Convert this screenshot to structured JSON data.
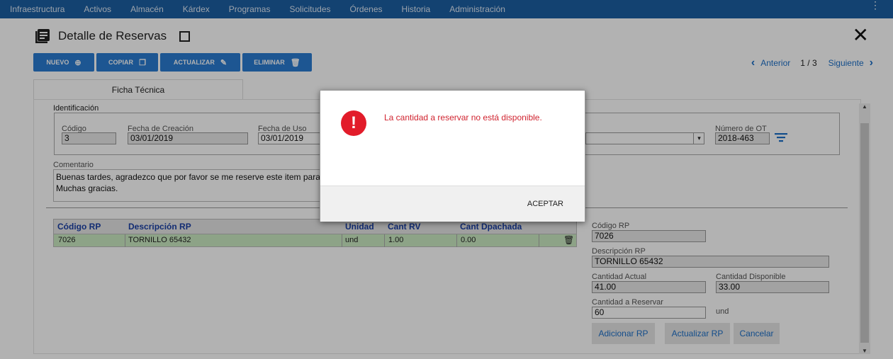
{
  "nav": {
    "items": [
      "Infraestructura",
      "Activos",
      "Almacén",
      "Kárdex",
      "Programas",
      "Solicitudes",
      "Órdenes",
      "Historia",
      "Administración"
    ],
    "menu_icon": "kebab-icon"
  },
  "header": {
    "title": "Detalle de Reservas",
    "icon": "document-list-icon"
  },
  "toolbar": {
    "nuevo": "NUEVO",
    "copiar": "COPIAR",
    "actualizar": "ACTUALIZAR",
    "eliminar": "ELIMINAR"
  },
  "pager": {
    "prev": "Anterior",
    "position": "1 / 3",
    "next": "Siguiente"
  },
  "tabs": {
    "ficha": "Ficha Técnica"
  },
  "identificacion": {
    "legend": "Identificación",
    "codigo_label": "Código",
    "codigo_value": "3",
    "fecha_creacion_label": "Fecha de Creación",
    "fecha_creacion_value": "03/01/2019",
    "fecha_uso_label": "Fecha de Uso",
    "fecha_uso_value": "03/01/2019",
    "numero_ot_label": "Número de OT",
    "numero_ot_value": "2018-463"
  },
  "comentario": {
    "label": "Comentario",
    "line1": "Buenas tardes, agradezco que por favor se me reserve este item para el",
    "line2": "Muchas gracias."
  },
  "grid": {
    "headers": [
      "Código RP",
      "Descripción RP",
      "Unidad",
      "Cant RV",
      "Cant Dpachada"
    ],
    "rows": [
      {
        "codigo": "7026",
        "descripcion": "TORNILLO 65432",
        "unidad": "und",
        "cant_rv": "1.00",
        "cant_despachada": "0.00"
      }
    ]
  },
  "detalle": {
    "codigo_rp_label": "Código RP",
    "codigo_rp_value": "7026",
    "descripcion_rp_label": "Descripción RP",
    "descripcion_rp_value": "TORNILLO 65432",
    "cantidad_actual_label": "Cantidad Actual",
    "cantidad_actual_value": "41.00",
    "cantidad_disponible_label": "Cantidad Disponible",
    "cantidad_disponible_value": "33.00",
    "cantidad_reservar_label": "Cantidad a Reservar",
    "cantidad_reservar_value": "60",
    "unidad": "und",
    "adicionar": "Adicionar RP",
    "actualizar": "Actualizar RP",
    "cancelar": "Cancelar"
  },
  "dialog": {
    "message": "La cantidad a reservar no está disponible.",
    "accept": "ACEPTAR",
    "icon_mark": "!"
  }
}
